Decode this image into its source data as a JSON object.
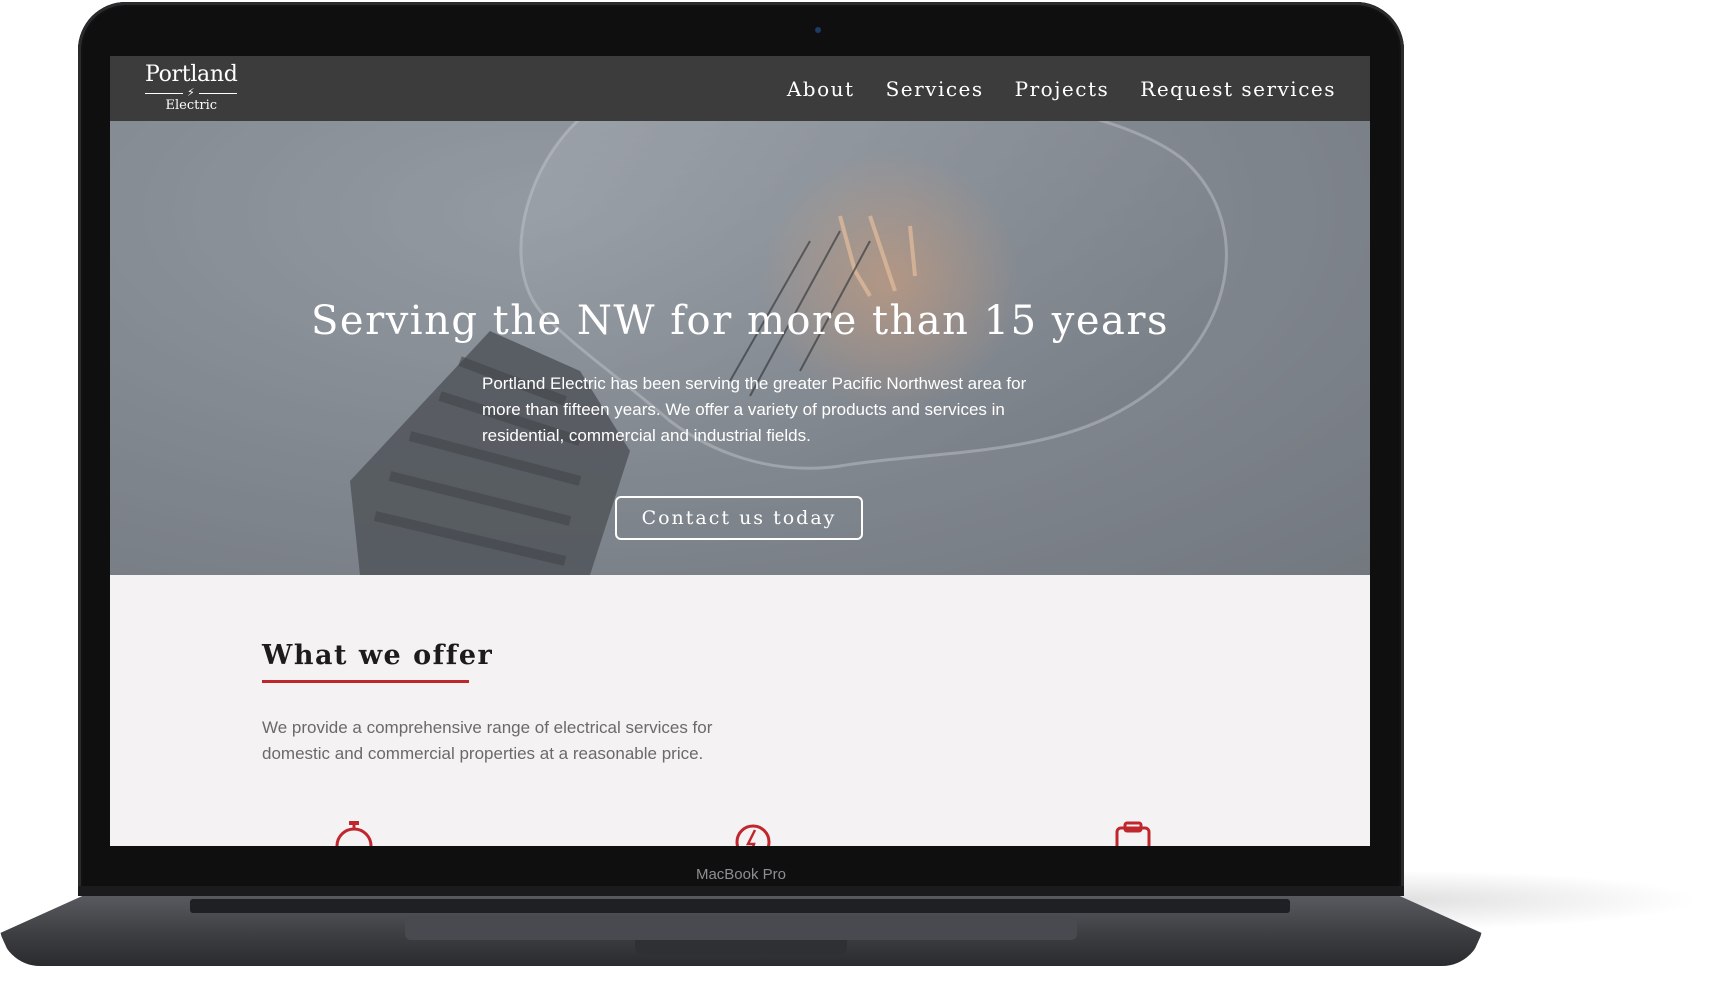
{
  "device": {
    "label": "MacBook Pro"
  },
  "nav": {
    "logo_top": "Portland",
    "logo_bottom": "Electric",
    "links": [
      "About",
      "Services",
      "Projects",
      "Request services"
    ]
  },
  "hero": {
    "title": "Serving the NW for more than 15 years",
    "text": "Portland Electric has been serving the greater Pacific Northwest area for more than fifteen years.  We offer a variety of products and services in residential, commercial and industrial fields.",
    "button_label": "Contact us today"
  },
  "offer": {
    "title": "What we offer",
    "text": "We provide a comprehensive range of electrical services for domestic and commercial properties at a reasonable price.",
    "icons": [
      "stopwatch-icon",
      "compass-bolt-icon",
      "clipboard-icon"
    ]
  },
  "colors": {
    "nav_bg": "#3c3c3c",
    "accent": "#c0272d",
    "page_bg": "#f4f2f3"
  }
}
